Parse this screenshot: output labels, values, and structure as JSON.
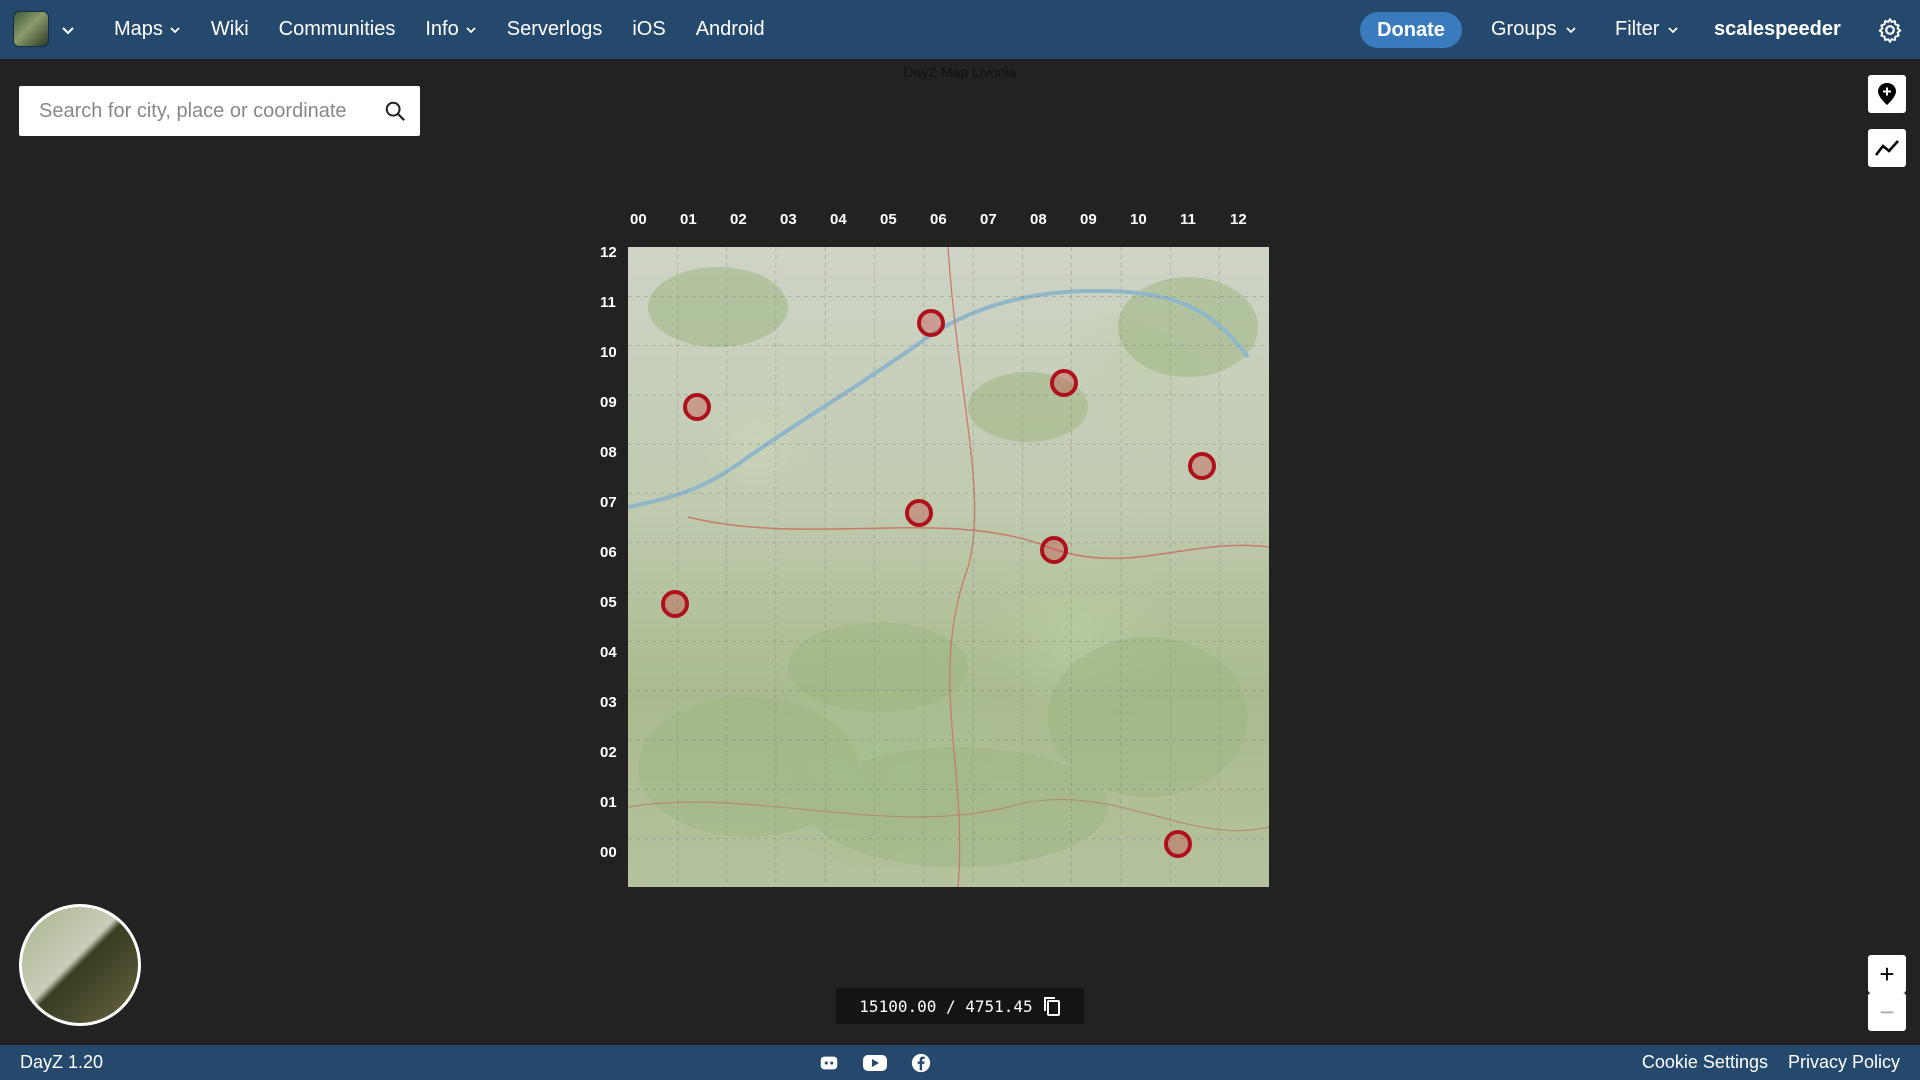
{
  "nav": {
    "items": [
      {
        "label": "Maps",
        "dropdown": true
      },
      {
        "label": "Wiki",
        "dropdown": false
      },
      {
        "label": "Communities",
        "dropdown": false
      },
      {
        "label": "Info",
        "dropdown": true
      },
      {
        "label": "Serverlogs",
        "dropdown": false
      },
      {
        "label": "iOS",
        "dropdown": false
      },
      {
        "label": "Android",
        "dropdown": false
      }
    ],
    "donate": "Donate",
    "groups": "Groups",
    "filter": "Filter",
    "username": "scalespeeder"
  },
  "map": {
    "title": "DayZ Map Livonia",
    "col_labels": [
      "00",
      "01",
      "02",
      "03",
      "04",
      "05",
      "06",
      "07",
      "08",
      "09",
      "10",
      "11",
      "12"
    ],
    "row_labels": [
      "12",
      "11",
      "10",
      "09",
      "08",
      "07",
      "06",
      "05",
      "04",
      "03",
      "02",
      "01",
      "00"
    ],
    "markers": [
      {
        "gx": 6.15,
        "gy": 1.55
      },
      {
        "gx": 1.4,
        "gy": 3.25
      },
      {
        "gx": 8.85,
        "gy": 2.75
      },
      {
        "gx": 11.65,
        "gy": 4.45
      },
      {
        "gx": 5.9,
        "gy": 5.4
      },
      {
        "gx": 8.65,
        "gy": 6.15
      },
      {
        "gx": 0.95,
        "gy": 7.25
      },
      {
        "gx": 11.15,
        "gy": 12.1
      }
    ]
  },
  "search": {
    "placeholder": "Search for city, place or coordinate"
  },
  "coords": {
    "value": "15100.00 / 4751.45"
  },
  "zoom": {
    "in": "+",
    "out": "−"
  },
  "footer": {
    "version": "DayZ 1.20",
    "cookie": "Cookie Settings",
    "privacy": "Privacy Policy"
  },
  "colors": {
    "nav_bg": "#25496d",
    "donate_bg": "#3a7bbd",
    "marker": "#b0101c",
    "page_bg": "#222222"
  }
}
